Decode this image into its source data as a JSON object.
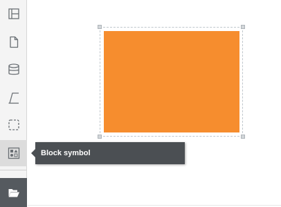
{
  "sidebar": {
    "tools": [
      {
        "icon": "layout-icon"
      },
      {
        "icon": "page-icon"
      },
      {
        "icon": "database-icon"
      },
      {
        "icon": "angle-line-icon"
      },
      {
        "icon": "selection-region-icon"
      },
      {
        "icon": "block-symbol-icon",
        "active": true
      },
      {
        "icon": "folder-open-icon"
      }
    ]
  },
  "tooltip": {
    "text": "Block symbol"
  },
  "canvas": {
    "shape": {
      "type": "rectangle",
      "fill": "#f68d2e",
      "selected": true
    }
  },
  "colors": {
    "sidebar_bg": "#f4f4f4",
    "tooltip_bg": "#4b4f53",
    "shape_fill": "#f68d2e",
    "selection_border": "#bfc6cc"
  }
}
